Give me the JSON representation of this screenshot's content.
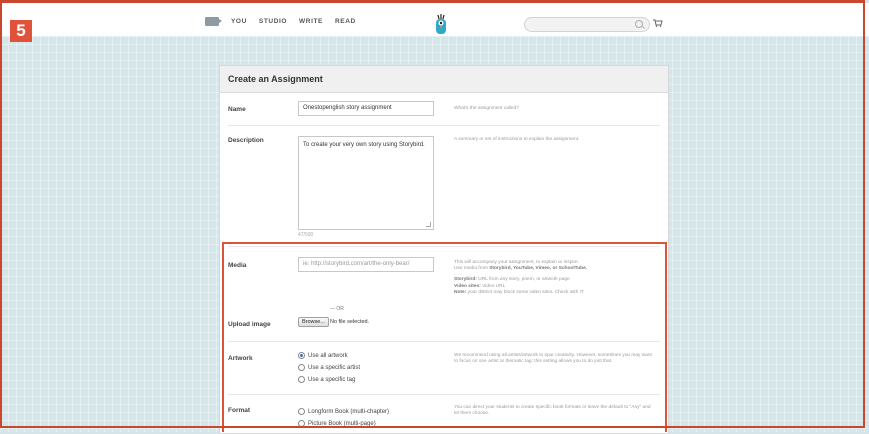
{
  "step_badge": "5",
  "nav": {
    "items": [
      "YOU",
      "STUDIO",
      "WRITE",
      "READ"
    ]
  },
  "form": {
    "title": "Create an Assignment",
    "name": {
      "label": "Name",
      "value": "Onestopenglish story assignment",
      "hint": "What's the assignment called?"
    },
    "description": {
      "label": "Description",
      "value": "To create your very own story using Storybird.",
      "counter": "47/500",
      "hint": "A summary or set of instructions to explain the assignment."
    },
    "media": {
      "label": "Media",
      "placeholder": "ie: http://storybird.com/art/the-only-bear/",
      "hint_line1": "This will accompany your assignment, to explain or inspire.",
      "hint_line2_prefix": "Use media from ",
      "hint_line2_bold": "Storybird, YouTube, Vimeo, or SchoolTube.",
      "hint_line3_bold": "Storybird:",
      "hint_line3": " URL from any story, poem, or artwork page",
      "hint_line4_bold": "Video sites:",
      "hint_line4": " Video URL",
      "hint_line5_bold": "Note:",
      "hint_line5": " your district may block some video sites. Check with IT."
    },
    "or_text": "— OR",
    "upload": {
      "label": "Upload image",
      "button": "Browse...",
      "status": "No file selected."
    },
    "artwork": {
      "label": "Artwork",
      "options": [
        "Use all artwork",
        "Use a specific artist",
        "Use a specific tag"
      ],
      "hint": "We recommend using all artists/artwork to spur creativity. However, sometimes you may want to focus on one artist or thematic tag; this setting allows you to do just that."
    },
    "format": {
      "label": "Format",
      "options": [
        "Longform Book (multi-chapter)",
        "Picture Book (multi-page)"
      ],
      "hint": "You can direct your students to create specific book formats or leave the default to \"Any\" and let them choose."
    }
  },
  "colors": {
    "highlight": "#d9553b",
    "badge": "#e0533a",
    "background": "#d5e6ea"
  }
}
